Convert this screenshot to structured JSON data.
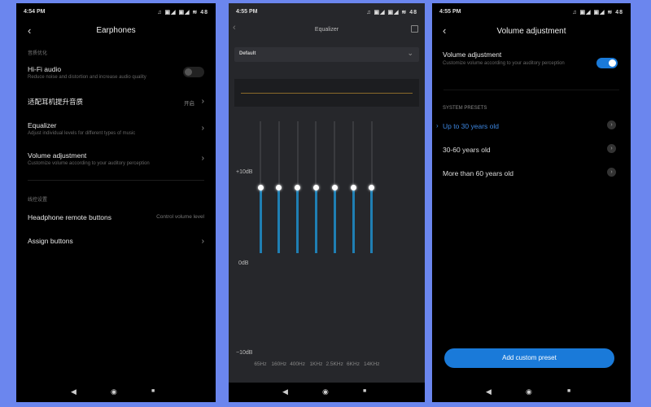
{
  "screen1": {
    "time": "4:54 PM",
    "status_icons": "♫ ▣◢ ▣◢ ≋ 48",
    "title": "Earphones",
    "section1": "音质优化",
    "hifi": {
      "title": "Hi-Fi audio",
      "subtitle": "Reduce noise and distortion and increase audio quality",
      "enabled": false
    },
    "adapt": {
      "title": "适配耳机提升音质",
      "value": "开启"
    },
    "equalizer": {
      "title": "Equalizer",
      "subtitle": "Adjust individual levels for different types of music"
    },
    "volume": {
      "title": "Volume adjustment",
      "subtitle": "Customize volume according to your auditory perception"
    },
    "section2": "线控设置",
    "remote": {
      "title": "Headphone remote buttons",
      "value": "Control volume level"
    },
    "assign": {
      "title": "Assign buttons"
    }
  },
  "screen2": {
    "time": "4:55 PM",
    "status_icons": "♫ ▣◢ ▣◢ ≋ 48",
    "title": "Equalizer",
    "preset": "Default",
    "db_labels": [
      "+10dB",
      "0dB",
      "−10dB"
    ],
    "bands": [
      {
        "label": "65Hz",
        "level": 0.5
      },
      {
        "label": "160Hz",
        "level": 0.5
      },
      {
        "label": "400Hz",
        "level": 0.5
      },
      {
        "label": "1KHz",
        "level": 0.5
      },
      {
        "label": "2.5KHz",
        "level": 0.5
      },
      {
        "label": "6KHz",
        "level": 0.5
      },
      {
        "label": "14KHz",
        "level": 0.5
      }
    ]
  },
  "screen3": {
    "time": "4:55 PM",
    "status_icons": "♫ ▣◢ ▣◢ ≋ 48",
    "title": "Volume adjustment",
    "toggle": {
      "title": "Volume adjustment",
      "subtitle": "Customize volume according to your auditory perception",
      "enabled": true
    },
    "section": "SYSTEM PRESETS",
    "presets": [
      {
        "label": "Up to 30 years old",
        "selected": true
      },
      {
        "label": "30-60 years old"
      },
      {
        "label": "More than 60 years old"
      }
    ],
    "add_button": "Add custom preset"
  },
  "nav": {
    "back": "◀",
    "home": "◉",
    "recents": "■"
  },
  "colors": {
    "accent": "#1a7ad9",
    "background": "#6b86ee",
    "eq_fill": "#1f7fb3"
  }
}
